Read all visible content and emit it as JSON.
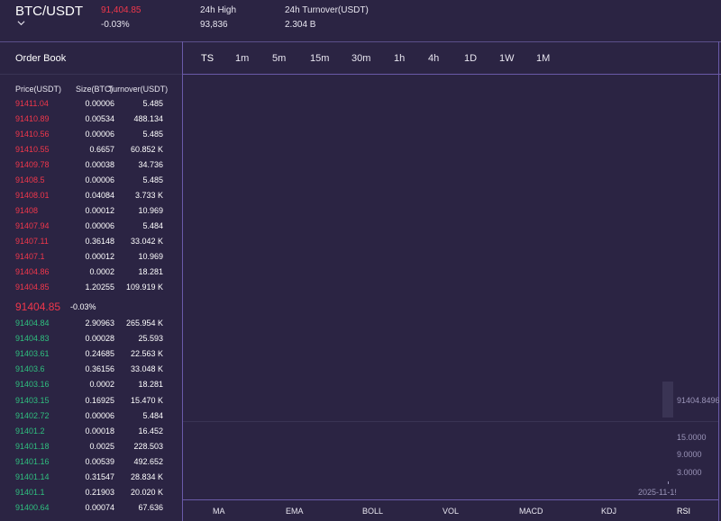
{
  "header": {
    "pair": "BTC/USDT",
    "last_price": "91,404.85",
    "change": "-0.03%",
    "high_label": "24h High",
    "high_value": "93,836",
    "turnover_label": "24h Turnover(USDT)",
    "turnover_value": "2.304 B"
  },
  "orderbook": {
    "title": "Order Book",
    "col_price": "Price(USDT)",
    "col_size": "Size(BTC)",
    "col_turnover": "Turnover(USDT)",
    "asks": [
      [
        "91411.04",
        "0.00006",
        "5.485"
      ],
      [
        "91410.89",
        "0.00534",
        "488.134"
      ],
      [
        "91410.56",
        "0.00006",
        "5.485"
      ],
      [
        "91410.55",
        "0.6657",
        "60.852 K"
      ],
      [
        "91409.78",
        "0.00038",
        "34.736"
      ],
      [
        "91408.5",
        "0.00006",
        "5.485"
      ],
      [
        "91408.01",
        "0.04084",
        "3.733 K"
      ],
      [
        "91408",
        "0.00012",
        "10.969"
      ],
      [
        "91407.94",
        "0.00006",
        "5.484"
      ],
      [
        "91407.11",
        "0.36148",
        "33.042 K"
      ],
      [
        "91407.1",
        "0.00012",
        "10.969"
      ],
      [
        "91404.86",
        "0.0002",
        "18.281"
      ],
      [
        "91404.85",
        "1.20255",
        "109.919 K"
      ]
    ],
    "mid_price": "91404.85",
    "mid_change": "-0.03%",
    "bids": [
      [
        "91404.84",
        "2.90963",
        "265.954 K"
      ],
      [
        "91404.83",
        "0.00028",
        "25.593"
      ],
      [
        "91403.61",
        "0.24685",
        "22.563 K"
      ],
      [
        "91403.6",
        "0.36156",
        "33.048 K"
      ],
      [
        "91403.16",
        "0.0002",
        "18.281"
      ],
      [
        "91403.15",
        "0.16925",
        "15.470 K"
      ],
      [
        "91402.72",
        "0.00006",
        "5.484"
      ],
      [
        "91401.2",
        "0.00018",
        "16.452"
      ],
      [
        "91401.18",
        "0.0025",
        "228.503"
      ],
      [
        "91401.16",
        "0.00539",
        "492.652"
      ],
      [
        "91401.14",
        "0.31547",
        "28.834 K"
      ],
      [
        "91401.1",
        "0.21903",
        "20.020 K"
      ],
      [
        "91400.64",
        "0.00074",
        "67.636"
      ]
    ]
  },
  "timeframes": [
    "TS",
    "1m",
    "5m",
    "15m",
    "30m",
    "1h",
    "4h",
    "1D",
    "1W",
    "1M"
  ],
  "chart": {
    "price_label": "91404.8496",
    "rsi_labels": [
      "15.0000",
      "9.0000",
      "3.0000"
    ],
    "time_label": "2025-11-1!"
  },
  "indicators": [
    "MA",
    "EMA",
    "BOLL",
    "VOL",
    "MACD",
    "KDJ",
    "RSI"
  ],
  "colors": {
    "ask": "#f0374b",
    "bid": "#2fbf7f",
    "background": "#2b2443",
    "divider": "#6a5aa8"
  },
  "icons": {
    "pair_dropdown": "chevron-down-icon"
  }
}
